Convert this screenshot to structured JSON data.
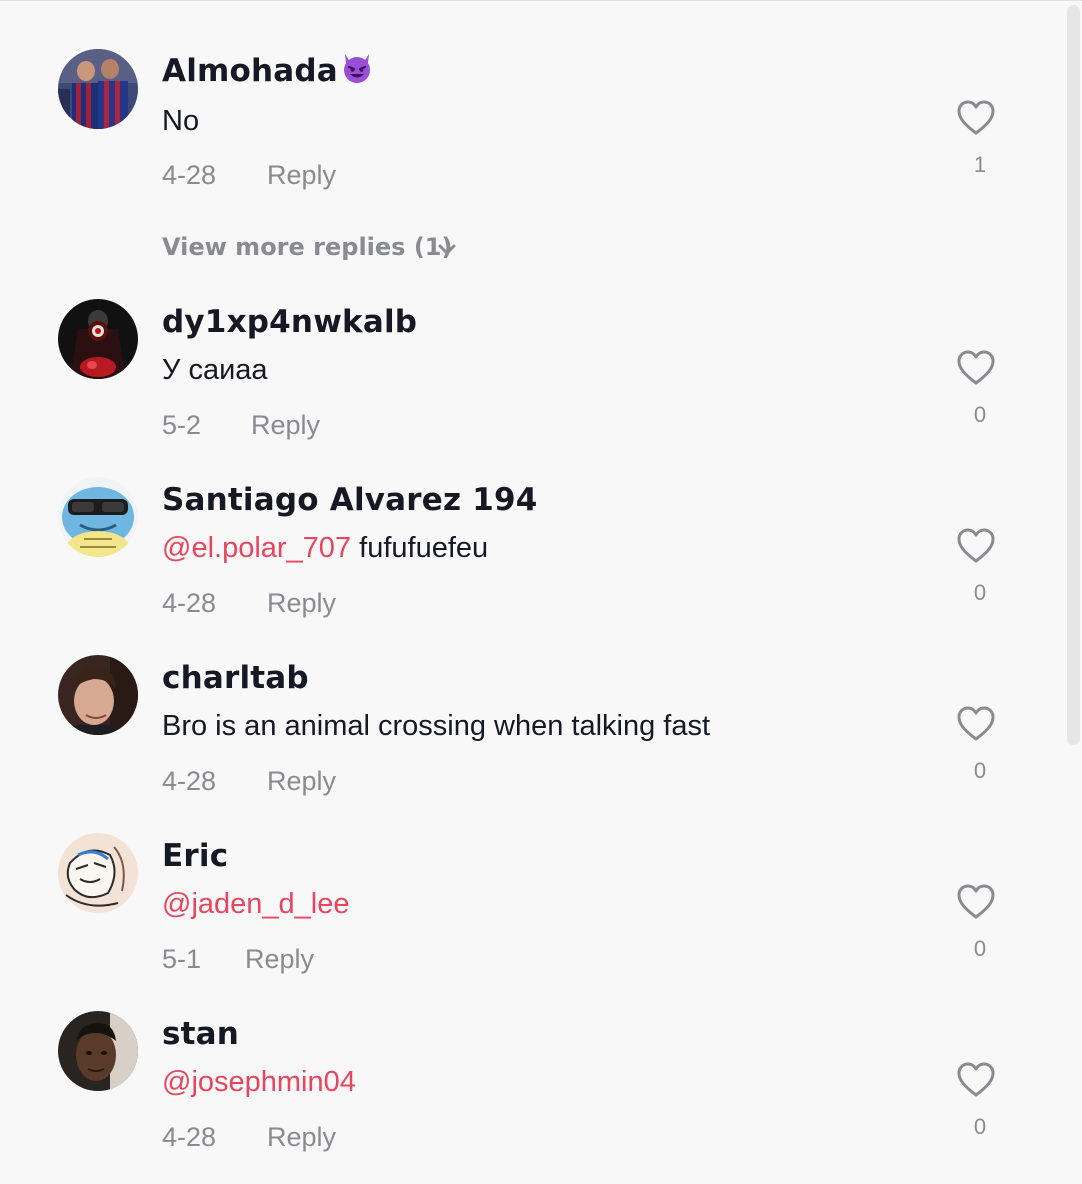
{
  "colors": {
    "background": "#f8f8f8",
    "username": "#161823",
    "secondary_text": "#8a8b91",
    "mention": "#e8455f",
    "heart_outline": "#8a8b91"
  },
  "comments": [
    {
      "username": "Almohada",
      "username_emoji": "smiling-face-with-horns",
      "text": "No",
      "date": "4-28",
      "reply_label": "Reply",
      "likes": "1",
      "view_more_replies": "View more replies (1)"
    },
    {
      "username": "dy1xp4nwkalb",
      "text": "У саиаа",
      "date": "5-2",
      "reply_label": "Reply",
      "likes": "0"
    },
    {
      "username": "Santiago Alvarez 194",
      "mention": "@el.polar_707",
      "text": " fufufuefeu",
      "date": "4-28",
      "reply_label": "Reply",
      "likes": "0"
    },
    {
      "username": "charltab",
      "text": "Bro is an animal crossing when talking fast",
      "date": "4-28",
      "reply_label": "Reply",
      "likes": "0"
    },
    {
      "username": "Eric",
      "mention": "@jaden_d_lee",
      "date": "5-1",
      "reply_label": "Reply",
      "likes": "0"
    },
    {
      "username": "stan",
      "mention": "@josephmin04",
      "date": "4-28",
      "reply_label": "Reply",
      "likes": "0"
    }
  ]
}
